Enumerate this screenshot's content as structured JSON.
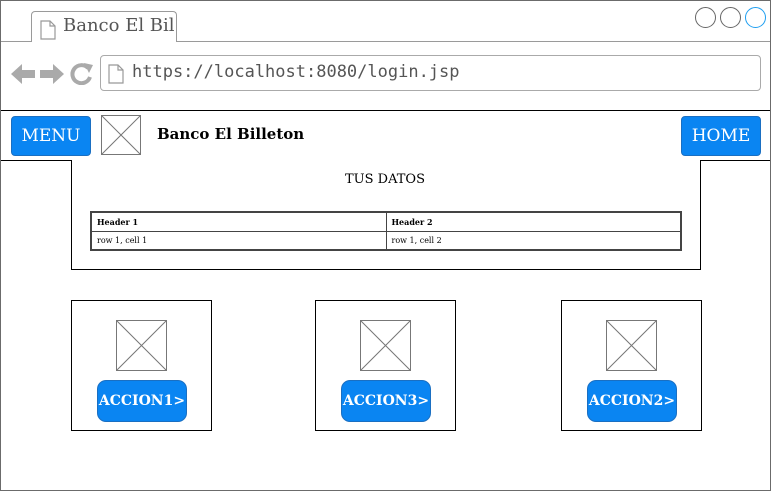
{
  "browser": {
    "tab_title": "Banco El Bil",
    "url": "https://localhost:8080/login.jsp"
  },
  "navbar": {
    "menu_label": "MENU",
    "brand": "Banco El Billeton",
    "home_label": "HOME"
  },
  "panel": {
    "title": "TUS DATOS",
    "table": {
      "headers": [
        "Header 1",
        "Header 2"
      ],
      "rows": [
        [
          "row 1, cell 1",
          "row 1, cell 2"
        ]
      ]
    }
  },
  "actions": [
    {
      "label": "ACCION1>"
    },
    {
      "label": "ACCION3>"
    },
    {
      "label": "ACCION2>"
    }
  ],
  "colors": {
    "accent": "#0a85f2",
    "window_button_active": "#1e9ef0"
  }
}
